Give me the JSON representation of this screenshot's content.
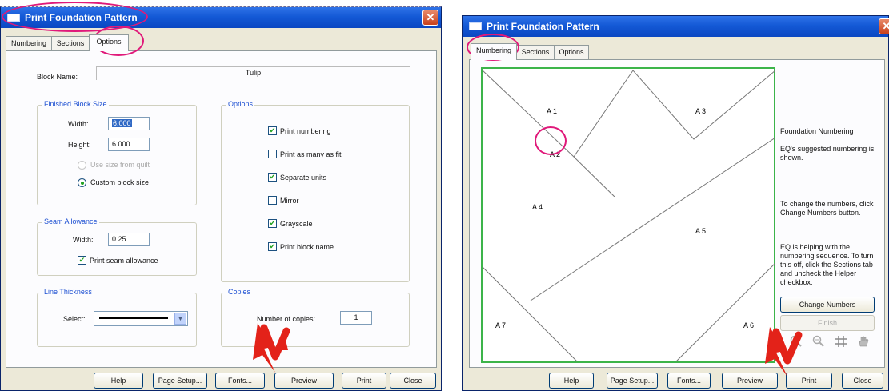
{
  "dialog_title": "Print Foundation Pattern",
  "close_glyph": "✕",
  "tabs": [
    "Numbering",
    "Sections",
    "Options"
  ],
  "left": {
    "block_name_label": "Block Name:",
    "block_name_value": "Tulip",
    "finished_block_size": {
      "title": "Finished Block Size",
      "width_label": "Width:",
      "width_value": "6.000",
      "height_label": "Height:",
      "height_value": "6.000",
      "use_size_label": "Use size from quilt",
      "custom_label": "Custom block size"
    },
    "options": {
      "title": "Options",
      "items": [
        {
          "label": "Print numbering",
          "checked": true
        },
        {
          "label": "Print as many as fit",
          "checked": false
        },
        {
          "label": "Separate units",
          "checked": true
        },
        {
          "label": "Mirror",
          "checked": false
        },
        {
          "label": "Grayscale",
          "checked": true
        },
        {
          "label": "Print block name",
          "checked": true
        }
      ]
    },
    "seam_allowance": {
      "title": "Seam Allowance",
      "width_label": "Width:",
      "width_value": "0.25",
      "print_label": "Print seam allowance"
    },
    "line_thickness": {
      "title": "Line Thickness",
      "select_label": "Select:"
    },
    "copies": {
      "title": "Copies",
      "label": "Number of copies:",
      "value": "1"
    }
  },
  "bottom_buttons": [
    "Help",
    "Page Setup...",
    "Fonts...",
    "Preview",
    "Print",
    "Close"
  ],
  "right": {
    "diagram_labels": [
      "A 1",
      "A 2",
      "A 3",
      "A 4",
      "A 5",
      "A 6",
      "A 7"
    ],
    "side_title": "Foundation Numbering",
    "side_paragraphs": [
      "EQ's suggested numbering is shown.",
      "To change the numbers, click Change Numbers button.",
      "EQ is helping with the numbering sequence. To turn this off, click the Sections tab and uncheck the Helper checkbox."
    ],
    "change_numbers_label": "Change Numbers",
    "finish_label": "Finish"
  },
  "colors": {
    "titlebar": "#0a47c2",
    "highlight": "#e0197a",
    "arrow": "#e32219",
    "diagram_border": "#3cb44a",
    "check": "#21a121"
  },
  "icons": [
    "dialog-icon",
    "close-icon",
    "zoom-in-icon",
    "zoom-out-icon",
    "grid-icon",
    "pan-hand-icon",
    "arrow-annotation-icon"
  ]
}
